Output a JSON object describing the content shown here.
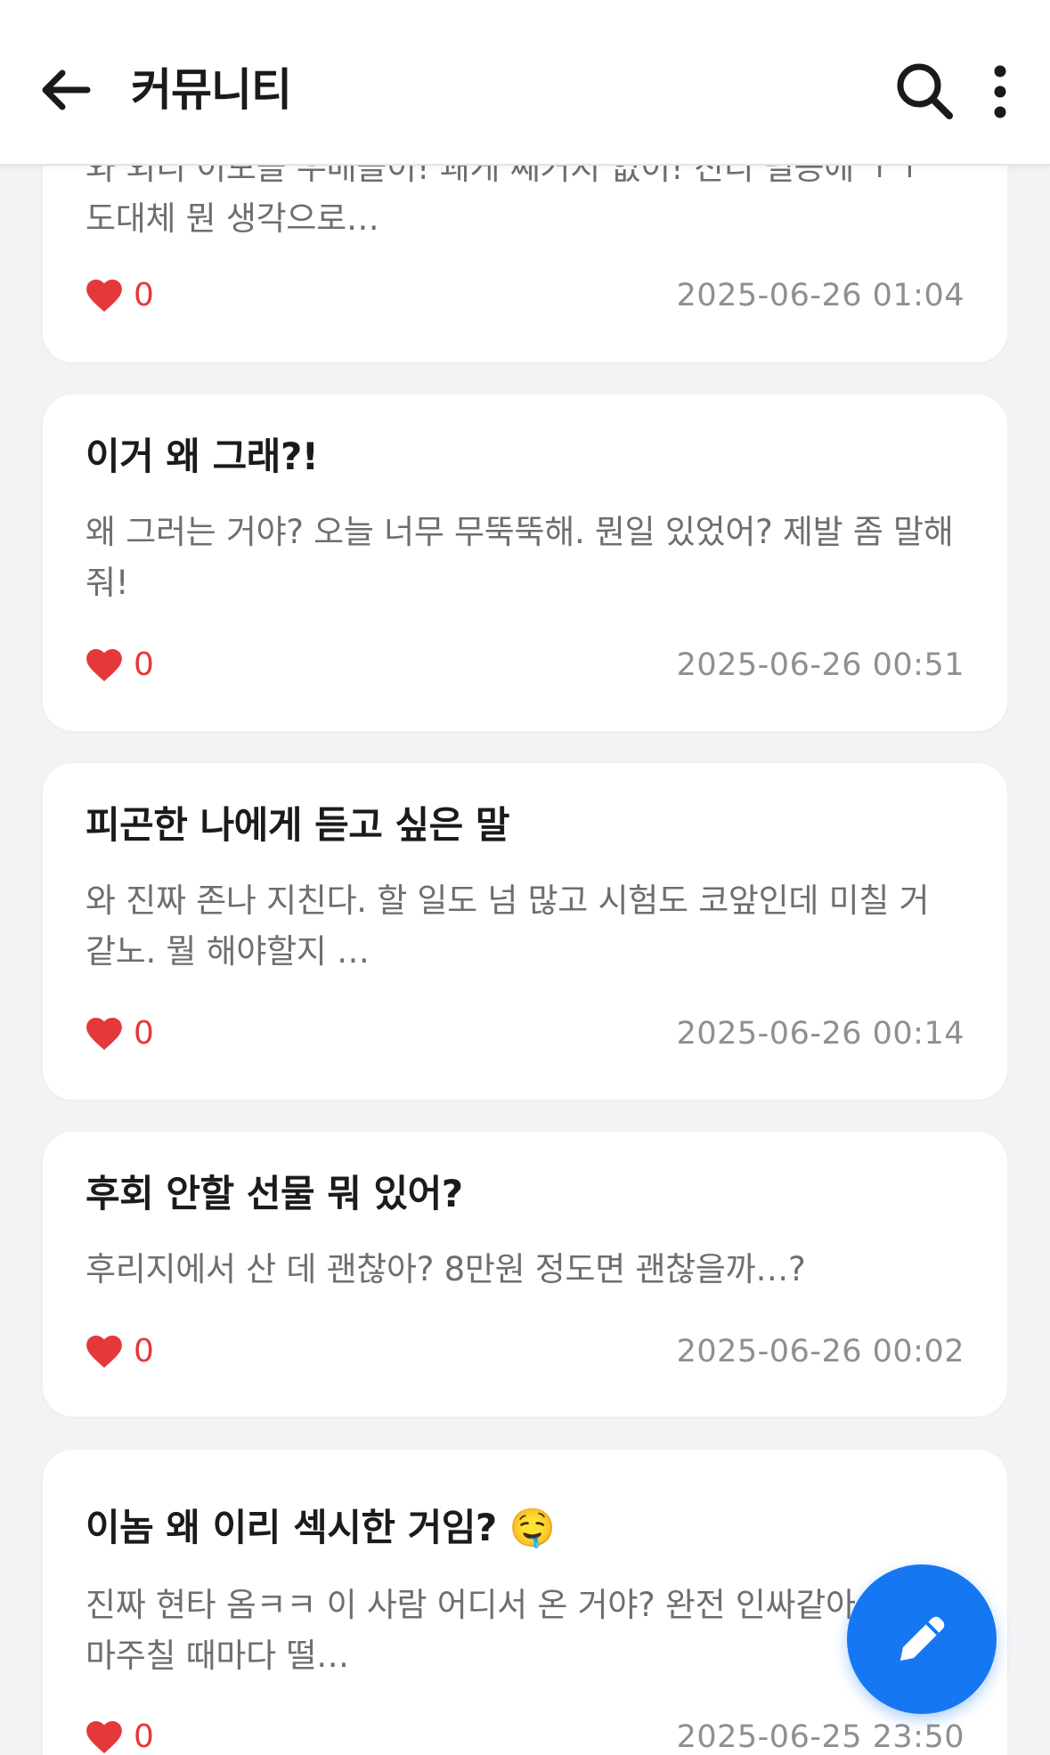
{
  "header": {
    "title": "커뮤니티"
  },
  "posts": [
    {
      "title": "",
      "preview": "와 외디 이모들 우배들이! 쾌게 째거지 없이! 진디 필공에 ㅜㅜ 도대체 뭔 생각으로…",
      "likes": "0",
      "date": "2025-06-26 01:04"
    },
    {
      "title": "이거 왜 그래?!",
      "preview": "왜 그러는 거야? 오늘 너무 무뚝뚝해. 뭔일 있었어? 제발 좀 말해줘!",
      "likes": "0",
      "date": "2025-06-26 00:51"
    },
    {
      "title": "피곤한 나에게 듣고 싶은 말",
      "preview": "와 진짜 존나 지친다. 할 일도 넘 많고 시험도 코앞인데 미칠 거 같노. 뭘 해야할지 …",
      "likes": "0",
      "date": "2025-06-26 00:14"
    },
    {
      "title": "후회 안할 선물 뭐 있어?",
      "preview": "후리지에서 산 데 괜찮아? 8만원 정도면 괜찮을까…?",
      "likes": "0",
      "date": "2025-06-26 00:02"
    },
    {
      "title": "이놈 왜 이리 섹시한 거임? 🤤",
      "preview": "진짜 현타 옴ㅋㅋ 이 사람 어디서 온 거야? 완전 인싸같아 ㅇ! 눈 마주칠 때마다 떨…",
      "likes": "0",
      "date": "2025-06-25 23:50"
    }
  ],
  "colors": {
    "accent": "#1677f2",
    "like": "#e5383b",
    "background": "#f2f3f5"
  },
  "icons": {
    "back": "arrow-left-icon",
    "search": "search-icon",
    "more": "more-vertical-icon",
    "like": "heart-icon",
    "write": "pencil-icon"
  }
}
